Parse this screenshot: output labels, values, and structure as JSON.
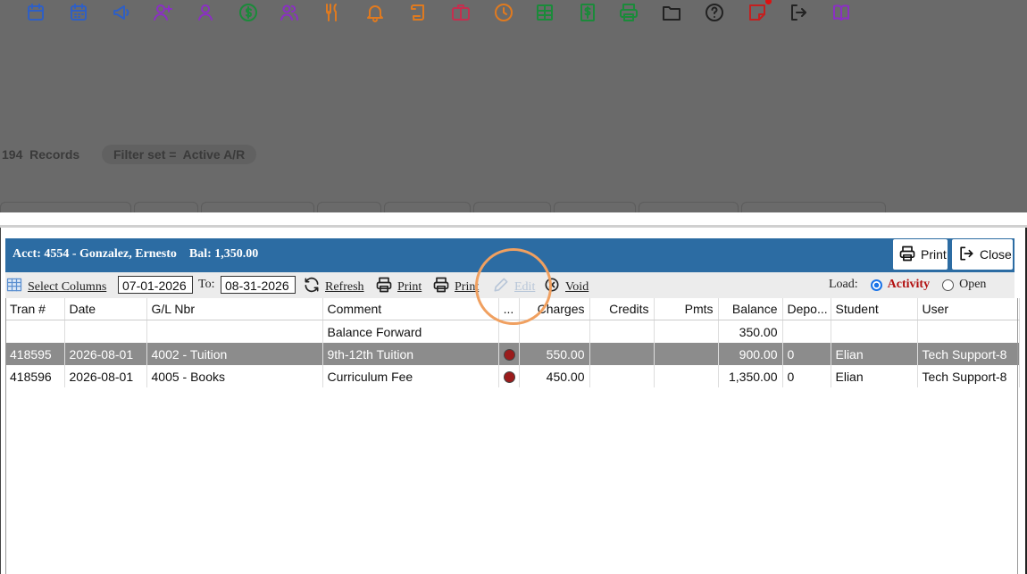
{
  "background": {
    "toolbar_icons": [
      {
        "name": "calendar-icon",
        "color": "#2f5fc4"
      },
      {
        "name": "calendar-grid-icon",
        "color": "#2f5fc4"
      },
      {
        "name": "megaphone-icon",
        "color": "#2f5fc4"
      },
      {
        "name": "add-user-icon",
        "color": "#8b2fc4"
      },
      {
        "name": "user-icon",
        "color": "#8b2fc4"
      },
      {
        "name": "dollar-circle-icon",
        "color": "#1b8a3a"
      },
      {
        "name": "users-icon",
        "color": "#8b2fc4"
      },
      {
        "name": "utensils-icon",
        "color": "#e07a1f"
      },
      {
        "name": "bell-icon",
        "color": "#e07a1f"
      },
      {
        "name": "scroll-icon",
        "color": "#e07a1f"
      },
      {
        "name": "briefcase-icon",
        "color": "#c42f4f"
      },
      {
        "name": "clock-icon",
        "color": "#e07a1f"
      },
      {
        "name": "table-icon",
        "color": "#1b8a3a"
      },
      {
        "name": "dollar-doc-icon",
        "color": "#1b8a3a"
      },
      {
        "name": "printer-icon",
        "color": "#1b8a3a"
      },
      {
        "name": "folder-icon",
        "color": "#222222"
      },
      {
        "name": "help-icon",
        "color": "#222222"
      },
      {
        "name": "sticky-note-icon",
        "color": "#c41f1f"
      },
      {
        "name": "logout-icon",
        "color": "#222222"
      },
      {
        "name": "book-icon",
        "color": "#8b2fc4"
      }
    ],
    "records_label": "194  Records",
    "filter_label": "Filter set =  Active A/R"
  },
  "dialog": {
    "header_title": "Acct: 4554 - Gonzalez, Ernesto    Bal: 1,350.00",
    "print_button": "Print",
    "close_button": "Close",
    "toolbar": {
      "select_columns": "Select Columns",
      "from_date": "07-01-2026",
      "to_label": "To:",
      "to_date": "08-31-2026",
      "refresh": "Refresh",
      "print1": "Print",
      "print2": "Print",
      "edit": "Edit",
      "void": "Void",
      "load_label": "Load:",
      "load_activity": "Activity",
      "load_open": "Open"
    },
    "columns": [
      "Tran #",
      "Date",
      "G/L Nbr",
      "Comment",
      "...",
      "Charges",
      "Credits",
      "Pmts",
      "Balance",
      "Depo...",
      "Student",
      "User"
    ],
    "rows": [
      {
        "tran": "",
        "date": "",
        "gl": "",
        "comment": "Balance Forward",
        "flag": false,
        "charges": "",
        "credits": "",
        "pmts": "",
        "balance": "350.00",
        "depo": "",
        "student": "",
        "user": "",
        "selected": false
      },
      {
        "tran": "418595",
        "date": "2026-08-01",
        "gl": "4002 - Tuition",
        "comment": "9th-12th Tuition",
        "flag": true,
        "charges": "550.00",
        "credits": "",
        "pmts": "",
        "balance": "900.00",
        "depo": "0",
        "student": "Elian",
        "user": "Tech Support-8",
        "selected": true
      },
      {
        "tran": "418596",
        "date": "2026-08-01",
        "gl": "4005 - Books",
        "comment": "Curriculum Fee",
        "flag": true,
        "charges": "450.00",
        "credits": "",
        "pmts": "",
        "balance": "1,350.00",
        "depo": "0",
        "student": "Elian",
        "user": "Tech Support-8",
        "selected": false
      }
    ],
    "colors": {
      "header_bg": "#2c6ca3",
      "selected_row": "#8c8c8c",
      "flag_dot": "#9b1c1c",
      "highlight_ring": "#f0a060"
    }
  }
}
